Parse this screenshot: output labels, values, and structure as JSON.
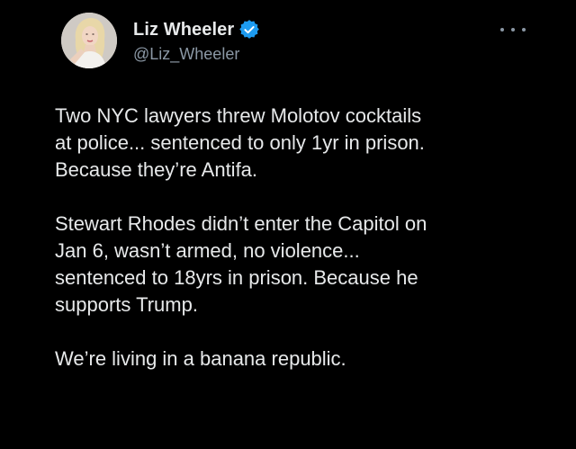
{
  "tweet": {
    "author": {
      "display_name": "Liz Wheeler",
      "handle": "@Liz_Wheeler",
      "verified": true,
      "avatar_icon": "profile-photo"
    },
    "more_icon": "ellipsis-icon",
    "paragraphs": [
      {
        "lines": [
          "Two NYC lawyers threw Molotov cocktails",
          "at police... sentenced to only 1yr in prison.",
          "Because they’re Antifa."
        ]
      },
      {
        "lines": [
          "Stewart Rhodes didn’t enter the Capitol on",
          "Jan 6, wasn’t armed, no violence...",
          "sentenced to 18yrs in prison. Because he",
          "supports Trump."
        ]
      },
      {
        "lines": [
          "We’re living in a banana republic."
        ]
      }
    ]
  },
  "colors": {
    "background": "#000000",
    "text_primary": "#e7e9ea",
    "text_secondary": "#8b98a5",
    "verified_badge": "#1d9bf0"
  }
}
